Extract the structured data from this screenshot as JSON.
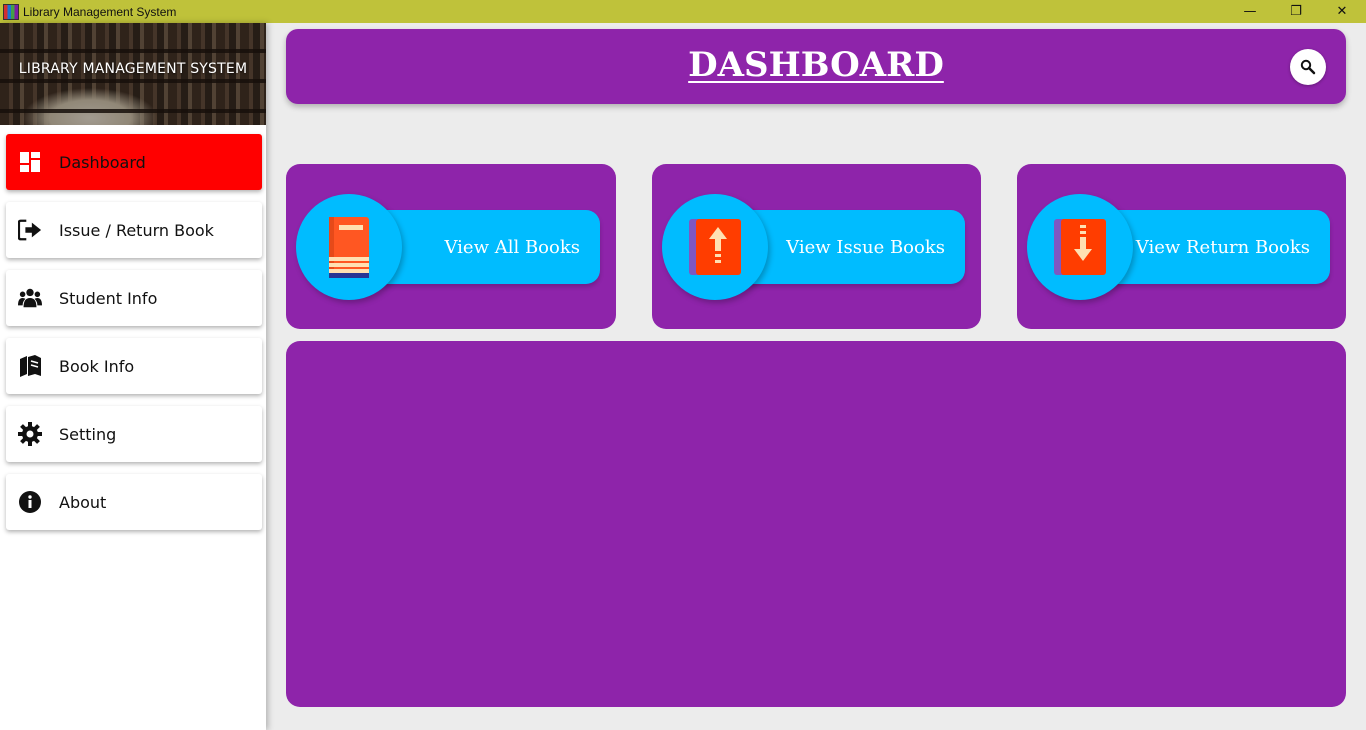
{
  "window": {
    "title": "Library Management System",
    "controls": {
      "minimize": "—",
      "maximize": "❐",
      "close": "✕"
    }
  },
  "sidebar": {
    "banner_title": "LIBRARY MANAGEMENT SYSTEM",
    "items": [
      {
        "label": "Dashboard",
        "icon": "dashboard-icon",
        "active": true
      },
      {
        "label": "Issue / Return Book",
        "icon": "sign-out-icon",
        "active": false
      },
      {
        "label": "Student Info",
        "icon": "users-icon",
        "active": false
      },
      {
        "label": "Book Info",
        "icon": "books-icon",
        "active": false
      },
      {
        "label": "Setting",
        "icon": "gear-icon",
        "active": false
      },
      {
        "label": "About",
        "icon": "info-icon",
        "active": false
      }
    ]
  },
  "header": {
    "title": "DASHBOARD",
    "search_icon": "search-icon"
  },
  "cards": [
    {
      "label": "View All Books",
      "icon": "book-icon"
    },
    {
      "label": "View Issue Books",
      "icon": "book-upload-icon"
    },
    {
      "label": "View Return Books",
      "icon": "book-download-icon"
    }
  ],
  "colors": {
    "accent_purple": "#8e24aa",
    "card_blue": "#00bcff",
    "active_red": "#ff0000",
    "titlebar": "#bfc23a",
    "background": "#ececec"
  }
}
